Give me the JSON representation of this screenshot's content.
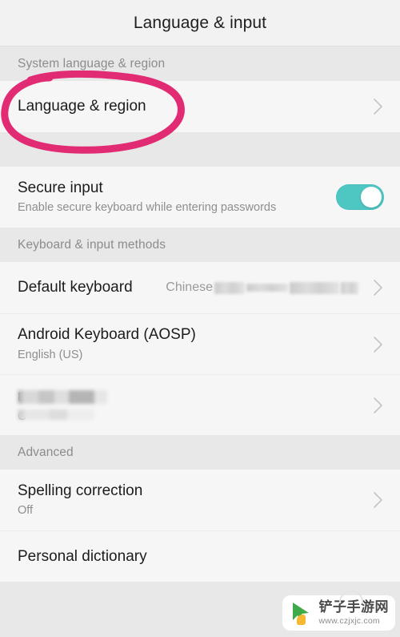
{
  "header": {
    "title": "Language & input"
  },
  "sections": [
    {
      "name": "system-language-region",
      "header": "System language & region",
      "rows": [
        {
          "name": "language-and-region",
          "title": "Language & region",
          "subtitle": "",
          "value": "",
          "accessory": "chevron",
          "annotated": true
        }
      ]
    },
    {
      "name": "secure-input-group",
      "header": "",
      "rows": [
        {
          "name": "secure-input",
          "title": "Secure input",
          "subtitle": "Enable secure keyboard while entering passwords",
          "value": "",
          "accessory": "toggle",
          "toggle_on": true
        }
      ]
    },
    {
      "name": "keyboard-input-methods",
      "header": "Keyboard & input methods",
      "rows": [
        {
          "name": "default-keyboard",
          "title": "Default keyboard",
          "subtitle": "",
          "value": "Chinese",
          "value_redacted": true,
          "accessory": "chevron"
        },
        {
          "name": "android-keyboard-aosp",
          "title": "Android Keyboard (AOSP)",
          "subtitle": "English (US)",
          "value": "",
          "accessory": "chevron"
        },
        {
          "name": "redacted-keyboard",
          "title": "",
          "title_redacted": true,
          "title_ghost": "L",
          "subtitle": "",
          "subtitle_redacted": true,
          "subtitle_ghost": "C",
          "value": "",
          "accessory": "chevron"
        }
      ]
    },
    {
      "name": "advanced",
      "header": "Advanced",
      "rows": [
        {
          "name": "spelling-correction",
          "title": "Spelling correction",
          "subtitle": "Off",
          "value": "",
          "accessory": "chevron"
        },
        {
          "name": "personal-dictionary",
          "title": "Personal dictionary",
          "subtitle": "",
          "value": "",
          "accessory": "none"
        }
      ]
    }
  ],
  "annotation": {
    "shape": "hand-drawn-ellipse",
    "color": "#e12b72",
    "target": "Language & region"
  },
  "watermark": {
    "name": "铲子手游网",
    "url": "www.czjxjc.com",
    "logo_color": "#3faa48"
  },
  "colors": {
    "page_background": "#e8e8e8",
    "row_background": "#f6f6f6",
    "titlebar_background": "#f2f2f2",
    "toggle_on": "#4ec6c2",
    "title_text": "#1c1c1c",
    "secondary_text": "#8e8e8e",
    "annotation_pink": "#e12b72"
  }
}
